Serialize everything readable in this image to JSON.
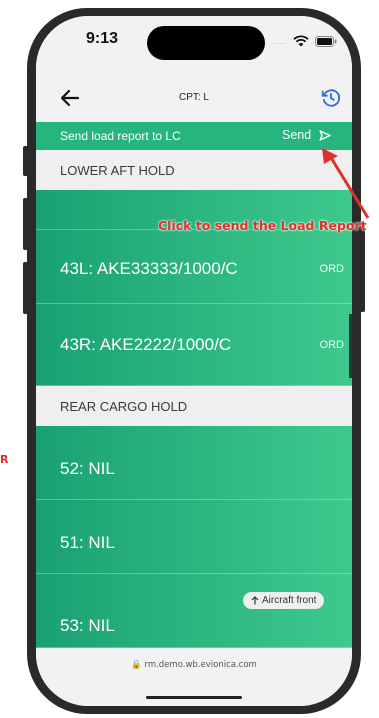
{
  "side_tag": "R",
  "status_bar": {
    "time": "9:13",
    "dots": "....",
    "icons": [
      "wifi-icon",
      "battery-icon"
    ]
  },
  "nav": {
    "title": "CPT: L",
    "back_icon": "back-arrow-icon",
    "history_icon": "history-icon"
  },
  "send_bar": {
    "label": "Send load report to LC",
    "button_label": "Send",
    "button_icon": "send-icon"
  },
  "sections": [
    {
      "title": "LOWER AFT HOLD",
      "rows": [
        {
          "label": "",
          "tag": ""
        },
        {
          "label": "43L: AKE33333/1000/C",
          "tag": "ORD"
        },
        {
          "label": "43R: AKE2222/1000/C",
          "tag": "ORD"
        }
      ]
    },
    {
      "title": "REAR CARGO HOLD",
      "rows": [
        {
          "label": "52: NIL"
        },
        {
          "label": "51: NIL"
        },
        {
          "label": "53: NIL"
        }
      ]
    }
  ],
  "aircraft_front_badge": "Aircraft front",
  "url": "rm.demo.wb.evionica.com",
  "annotation": "Click to send the Load Report",
  "colors": {
    "accent": "#25b57d",
    "annotation": "#e0302a"
  }
}
